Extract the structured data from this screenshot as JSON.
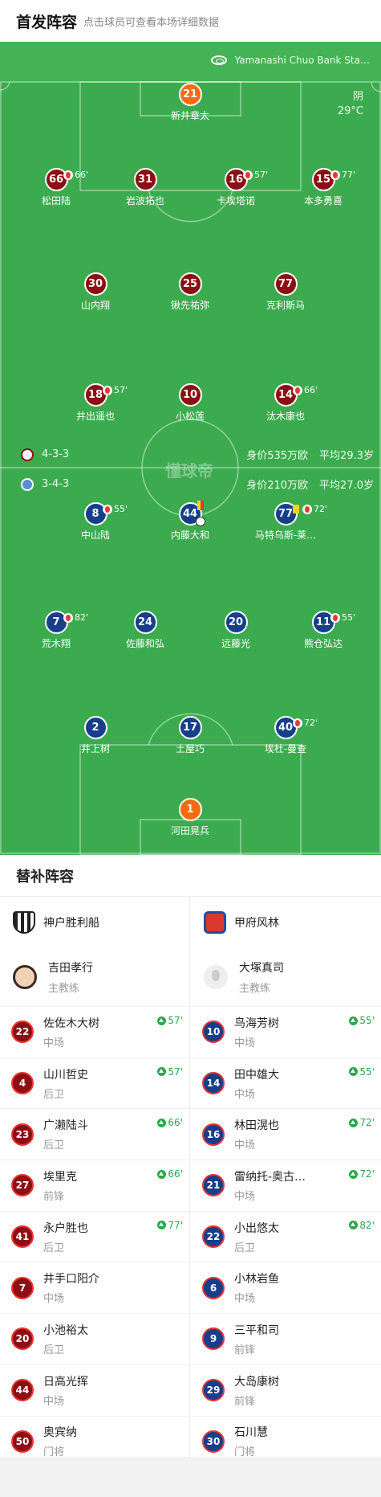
{
  "header": {
    "title": "首发阵容",
    "hint": "点击球员可查看本场详细数据"
  },
  "pitch": {
    "stadium": "Yamanashi Chuo Bank Sta…",
    "weather": "阴",
    "temperature": "29°C",
    "watermark": "懂球帝",
    "home_formation": "4-3-3",
    "home_value": "身价535万欧",
    "home_age": "平均29.3岁",
    "away_formation": "3-4-3",
    "away_value": "身价210万欧",
    "away_age": "平均27.0岁",
    "home_players": [
      {
        "num": "21",
        "name": "新井章太"
      },
      {
        "num": "66",
        "name": "松田陆",
        "sub": "66'"
      },
      {
        "num": "31",
        "name": "岩波拓也"
      },
      {
        "num": "16",
        "name": "卡埃塔诺",
        "sub": "57'"
      },
      {
        "num": "15",
        "name": "本多勇喜",
        "sub": "77'"
      },
      {
        "num": "30",
        "name": "山内翔"
      },
      {
        "num": "25",
        "name": "锹先祐弥"
      },
      {
        "num": "77",
        "name": "克利斯马"
      },
      {
        "num": "18",
        "name": "井出遥也",
        "sub": "57'"
      },
      {
        "num": "10",
        "name": "小松莲"
      },
      {
        "num": "14",
        "name": "汰木康也",
        "sub": "66'"
      }
    ],
    "away_players": [
      {
        "num": "8",
        "name": "中山陆",
        "sub": "55'"
      },
      {
        "num": "44",
        "name": "内藤大和"
      },
      {
        "num": "77",
        "name": "马特乌斯-莱…",
        "sub": "72'"
      },
      {
        "num": "7",
        "name": "荒木翔",
        "sub": "82'"
      },
      {
        "num": "24",
        "name": "佐藤和弘"
      },
      {
        "num": "20",
        "name": "远藤光"
      },
      {
        "num": "11",
        "name": "熊仓弘达",
        "sub": "55'"
      },
      {
        "num": "2",
        "name": "井上树"
      },
      {
        "num": "17",
        "name": "土屋巧"
      },
      {
        "num": "40",
        "name": "埃杜-曼查",
        "sub": "72'"
      },
      {
        "num": "1",
        "name": "河田晃兵"
      }
    ]
  },
  "subs": {
    "title": "替补阵容",
    "home": {
      "team": "神户胜利船",
      "coach": "吉田孝行",
      "coach_role": "主教练",
      "players": [
        {
          "num": "22",
          "name": "佐佐木大树",
          "pos": "中场",
          "in": "57'"
        },
        {
          "num": "4",
          "name": "山川哲史",
          "pos": "后卫",
          "in": "57'"
        },
        {
          "num": "23",
          "name": "广濑陆斗",
          "pos": "后卫",
          "in": "66'"
        },
        {
          "num": "27",
          "name": "埃里克",
          "pos": "前锋",
          "in": "66'"
        },
        {
          "num": "41",
          "name": "永户胜也",
          "pos": "后卫",
          "in": "77'"
        },
        {
          "num": "7",
          "name": "井手口阳介",
          "pos": "中场"
        },
        {
          "num": "20",
          "name": "小池裕太",
          "pos": "后卫"
        },
        {
          "num": "44",
          "name": "日高光挥",
          "pos": "中场"
        },
        {
          "num": "50",
          "name": "奥宾纳",
          "pos": "门将"
        }
      ]
    },
    "away": {
      "team": "甲府风林",
      "coach": "大塚真司",
      "coach_role": "主教练",
      "players": [
        {
          "num": "10",
          "name": "鸟海芳树",
          "pos": "中场",
          "in": "55'"
        },
        {
          "num": "14",
          "name": "田中雄大",
          "pos": "中场",
          "in": "55'"
        },
        {
          "num": "16",
          "name": "林田滉也",
          "pos": "中场",
          "in": "72'"
        },
        {
          "num": "21",
          "name": "雷纳托-奥古…",
          "pos": "中场",
          "in": "72'"
        },
        {
          "num": "22",
          "name": "小出悠太",
          "pos": "后卫",
          "in": "82'"
        },
        {
          "num": "6",
          "name": "小林岩鱼",
          "pos": "中场"
        },
        {
          "num": "9",
          "name": "三平和司",
          "pos": "前锋"
        },
        {
          "num": "29",
          "name": "大岛康树",
          "pos": "前锋"
        },
        {
          "num": "30",
          "name": "石川慧",
          "pos": "门将"
        }
      ]
    }
  }
}
